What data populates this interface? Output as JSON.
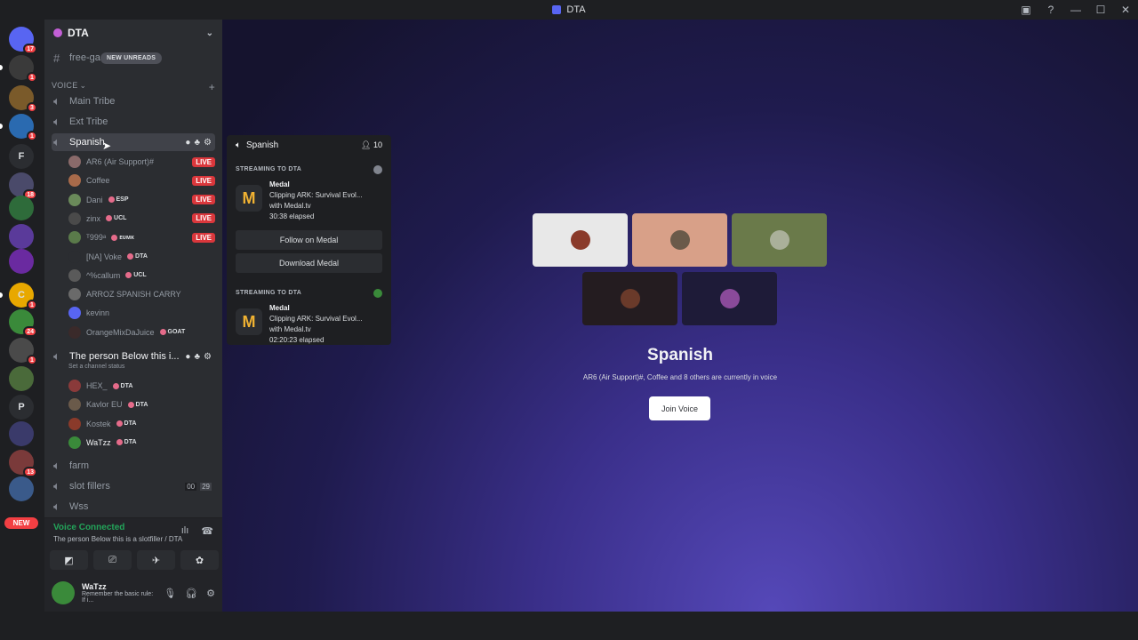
{
  "window": {
    "title": "DTA"
  },
  "servers": [
    {
      "initial": "",
      "color": "#5865f2",
      "badge": "17"
    },
    {
      "initial": "",
      "color": "#3a3a3a",
      "badge": "1"
    },
    {
      "initial": "",
      "color": "#7a5a2a",
      "badge": "3"
    },
    {
      "initial": "",
      "color": "#2a6ab0",
      "badge": "1"
    },
    {
      "initial": "F",
      "color": "#2b2d31",
      "badge": ""
    },
    {
      "initial": "",
      "color": "#4a4a6a",
      "badge": "18"
    },
    {
      "initial": "",
      "color": "#2e6b3a",
      "badge": ""
    },
    {
      "initial": "",
      "color": "#5a3a9a",
      "badge": ""
    },
    {
      "initial": "",
      "color": "#6a2aa0",
      "badge": ""
    },
    {
      "initial": "C",
      "color": "#e8a800",
      "badge": "1"
    },
    {
      "initial": "",
      "color": "#3a8a3a",
      "badge": "24"
    },
    {
      "initial": "",
      "color": "#4a4a4a",
      "badge": "1"
    },
    {
      "initial": "",
      "color": "#4a6a3a",
      "badge": ""
    },
    {
      "initial": "P",
      "color": "#2b2d31",
      "badge": ""
    },
    {
      "initial": "",
      "color": "#3a3a6a",
      "badge": ""
    },
    {
      "initial": "",
      "color": "#7a3a3a",
      "badge": "13"
    },
    {
      "initial": "",
      "color": "#3a5a8a",
      "badge": ""
    }
  ],
  "new_badge": "NEW",
  "guild": {
    "name": "DTA"
  },
  "new_unreads": "NEW UNREADS",
  "channels": {
    "free": "free-ga",
    "voice_category": "VOICE",
    "main_tribe": "Main Tribe",
    "ext_tribe": "Ext Tribe",
    "spanish": "Spanish",
    "person_below": "The person Below this i...",
    "person_status": "Set a channel status",
    "farm": "farm",
    "slot_fillers": "slot fillers",
    "slot_a": "00",
    "slot_b": "29",
    "wss": "Wss"
  },
  "spanish_users": [
    {
      "name": "AR6 (Air Support)#",
      "tag": "",
      "live": "LIVE",
      "color": "#8a6a6a"
    },
    {
      "name": "Coffee",
      "tag": "",
      "live": "LIVE",
      "color": "#a86a4a"
    },
    {
      "name": "Dani",
      "tag": "ESP",
      "live": "LIVE",
      "color": "#6a8a5a"
    },
    {
      "name": "zinx",
      "tag": "UCL",
      "live": "LIVE",
      "color": "#4a4a4a"
    },
    {
      "name": "ᵀ999ᵃ",
      "tag": "ᴇᴜᴍᴋ",
      "live": "LIVE",
      "color": "#5a7a4a"
    },
    {
      "name": "[NA] Voke",
      "tag": "DTA",
      "live": "",
      "color": "#2b2d31"
    },
    {
      "name": "^%callum",
      "tag": "UCL",
      "live": "",
      "color": "#5a5a5a"
    },
    {
      "name": "ARROZ SPANISH CARRY",
      "tag": "",
      "live": "",
      "color": "#6a6a6a"
    },
    {
      "name": "kevinn",
      "tag": "",
      "live": "",
      "color": "#5865f2"
    },
    {
      "name": "OrangeMixDaJuice",
      "tag": "GOAT",
      "live": "",
      "color": "#3a2a2a"
    }
  ],
  "person_users": [
    {
      "name": "HEX_",
      "tag": "DTA",
      "color": "#8a3a3a"
    },
    {
      "name": "Kavlor EU",
      "tag": "DTA",
      "color": "#6a5a4a"
    },
    {
      "name": "Kostek",
      "tag": "DTA",
      "color": "#8a3a2a"
    },
    {
      "name": "WaTzz",
      "tag": "DTA",
      "color": "#3a8a3a"
    }
  ],
  "voice_panel": {
    "title": "Voice Connected",
    "sub": "The person Below this is a slotfiller / DTA"
  },
  "user_panel": {
    "name": "WaTzz",
    "status": "Remember the basic rule: If i..."
  },
  "popup": {
    "title": "Spanish",
    "count": "10",
    "stream_label": "STREAMING TO DTA",
    "streams": [
      {
        "app": "Medal",
        "line1": "Clipping ARK: Survival Evol...",
        "line2": "with Medal.tv",
        "elapsed": "30:38 elapsed"
      },
      {
        "app": "Medal",
        "line1": "Clipping ARK: Survival Evol...",
        "line2": "with Medal.tv",
        "elapsed": "02:20:23 elapsed"
      }
    ],
    "follow": "Follow on Medal",
    "download": "Download Medal"
  },
  "main": {
    "title": "Spanish",
    "sub": "AR6 (Air Support)#, Coffee and 8 others are currently in voice",
    "join": "Join Voice"
  },
  "colors": {
    "accent": "#5865f2",
    "live": "#da373c",
    "connected": "#23a55a"
  }
}
